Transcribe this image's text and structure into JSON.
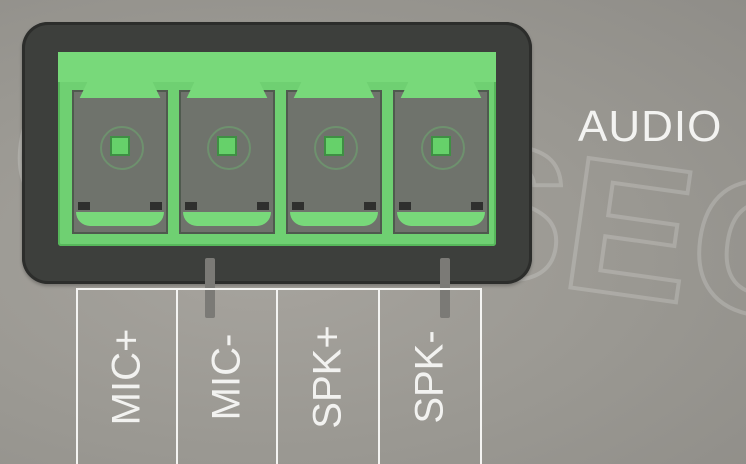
{
  "brand_side_label": "AUDIO",
  "terminal_labels": [
    "MIC+",
    "MIC-",
    "SPK+",
    "SPK-"
  ],
  "colors": {
    "terminal_green": "#6fd072",
    "housing": "#3d3f3c",
    "panel": "#9a9892",
    "label": "#f4f4f2"
  }
}
